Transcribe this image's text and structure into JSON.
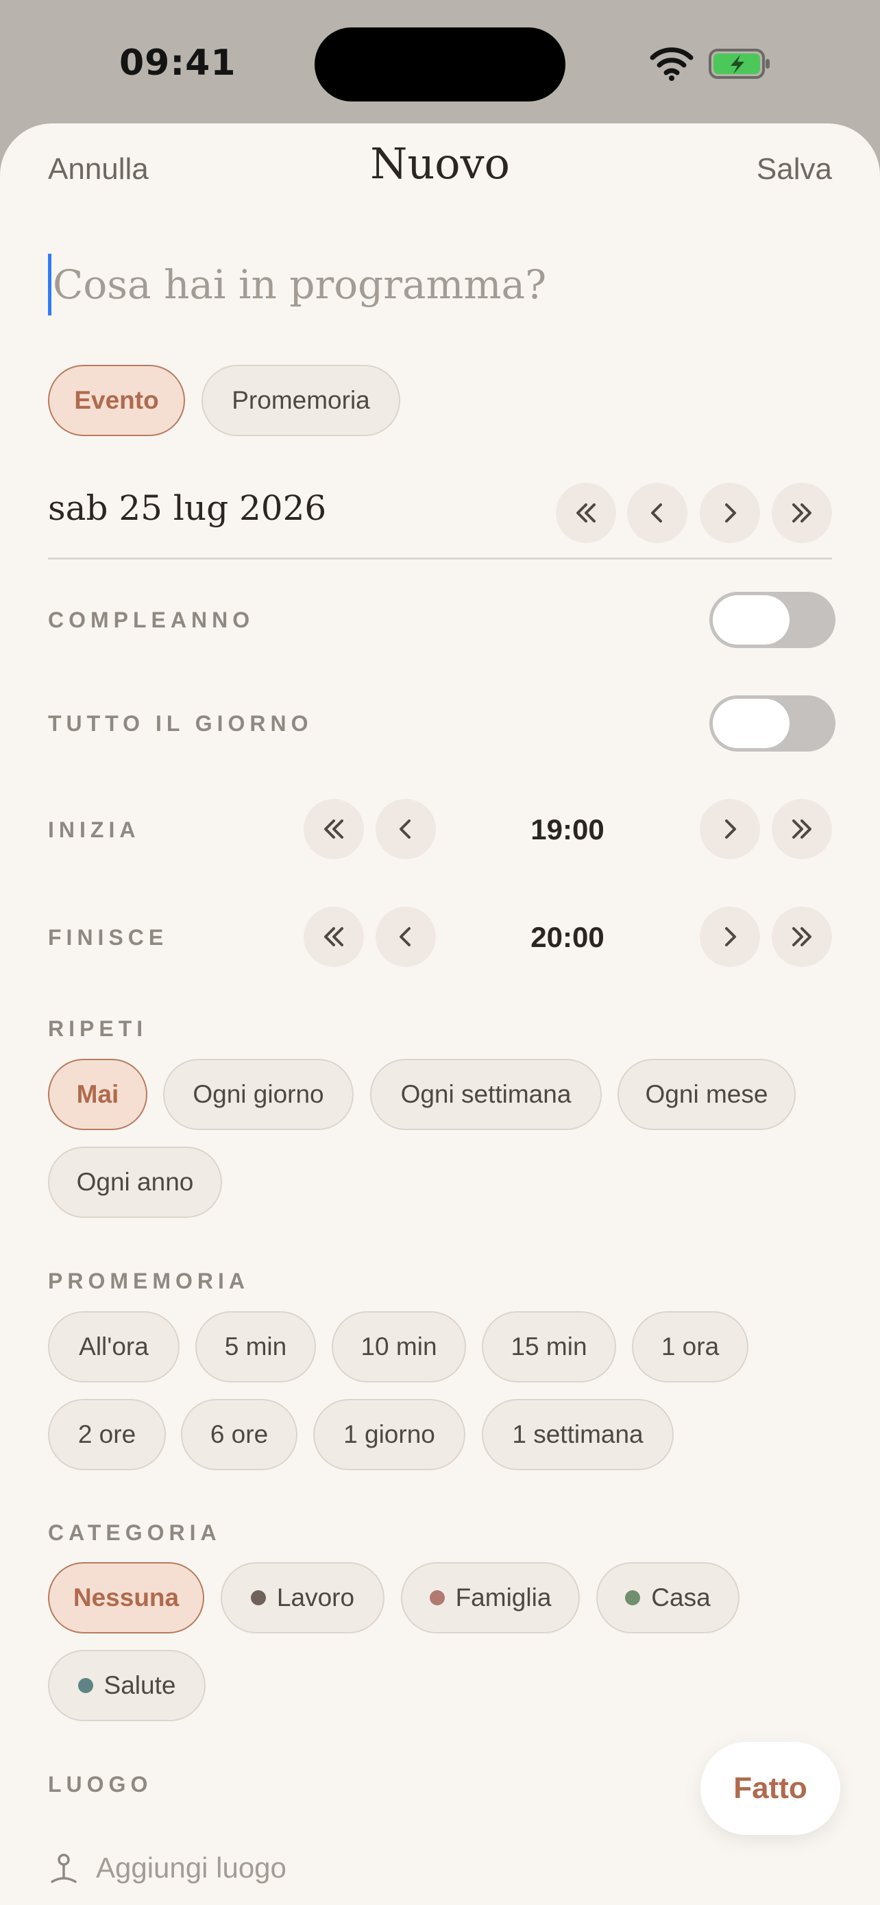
{
  "status_bar": {
    "time": "09:41"
  },
  "nav": {
    "cancel": "Annulla",
    "title": "Nuovo",
    "save": "Salva"
  },
  "title_input": {
    "placeholder": "Cosa hai in programma?",
    "value": ""
  },
  "type": {
    "options": [
      "Evento",
      "Promemoria"
    ],
    "selected": "Evento"
  },
  "date": {
    "label": "sab 25 lug 2026"
  },
  "birthday": {
    "label": "COMPLEANNO",
    "on": false
  },
  "all_day": {
    "label": "TUTTO IL GIORNO",
    "on": false
  },
  "start": {
    "label": "INIZIA",
    "time": "19:00"
  },
  "end": {
    "label": "FINISCE",
    "time": "20:00"
  },
  "repeat": {
    "label": "RIPETI",
    "options": [
      "Mai",
      "Ogni giorno",
      "Ogni settimana",
      "Ogni mese",
      "Ogni anno"
    ],
    "selected": "Mai"
  },
  "reminder": {
    "label": "PROMEMORIA",
    "options": [
      "All'ora",
      "5 min",
      "10 min",
      "15 min",
      "1 ora",
      "2 ore",
      "6 ore",
      "1 giorno",
      "1 settimana"
    ]
  },
  "category": {
    "label": "CATEGORIA",
    "options": [
      {
        "label": "Nessuna",
        "color": null
      },
      {
        "label": "Lavoro",
        "color": "#6e625a"
      },
      {
        "label": "Famiglia",
        "color": "#b07a70"
      },
      {
        "label": "Casa",
        "color": "#6f8f6f"
      },
      {
        "label": "Salute",
        "color": "#5f8485"
      }
    ],
    "selected": "Nessuna"
  },
  "location": {
    "label": "LUOGO",
    "placeholder": "Aggiungi luogo"
  },
  "done_button": "Fatto",
  "colors": {
    "accent": "#b06a4d",
    "accent_bg": "#f5dfd3",
    "background": "#f9f6f2"
  }
}
